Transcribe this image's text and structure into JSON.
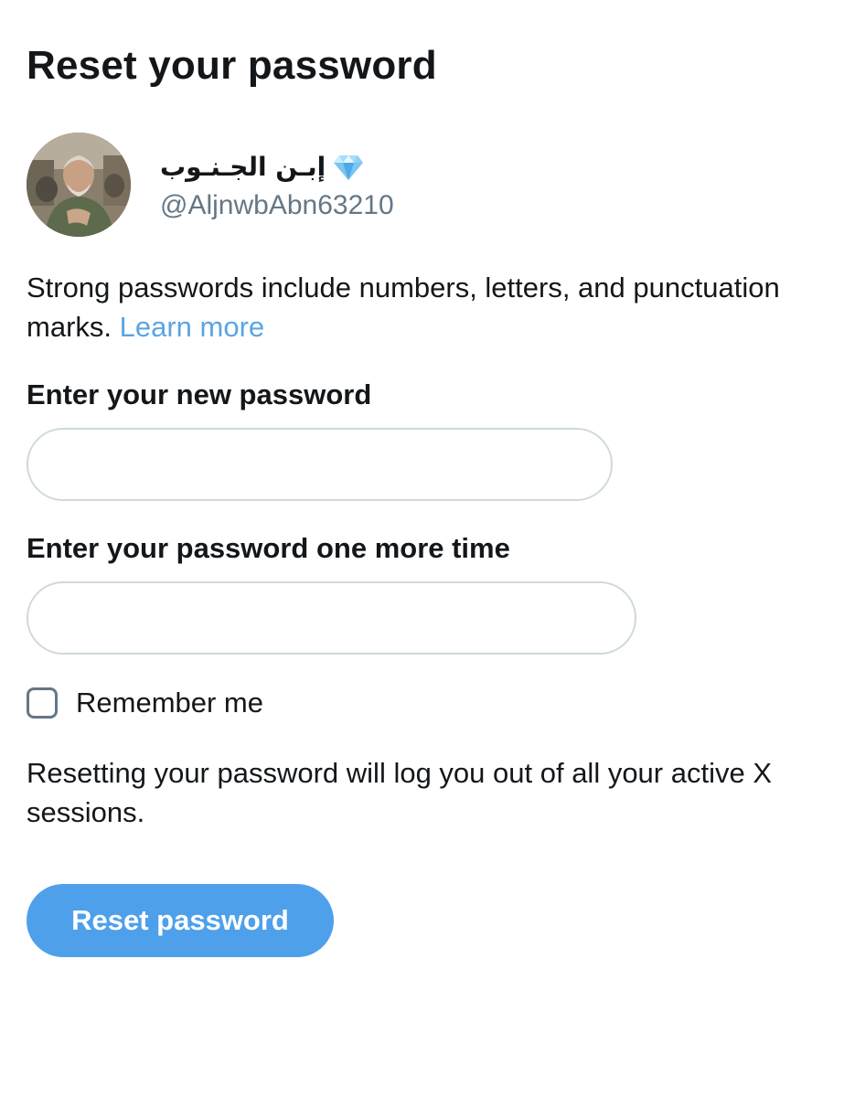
{
  "page": {
    "title": "Reset your password"
  },
  "account": {
    "display_name": "إبـن الجـنـوب",
    "badge_icon": "gem-icon",
    "handle": "@AljnwbAbn63210"
  },
  "info": {
    "text": "Strong passwords include numbers, letters, and punctuation marks.",
    "link_label": "Learn more"
  },
  "form": {
    "new_password_label": "Enter your new password",
    "new_password_value": "",
    "confirm_password_label": "Enter your password one more time",
    "confirm_password_value": "",
    "remember_label": "Remember me",
    "remember_checked": false
  },
  "notice": {
    "text": "Resetting your password will log you out of all your active X sessions."
  },
  "actions": {
    "reset_label": "Reset password"
  },
  "colors": {
    "accent": "#4ea0ea",
    "link": "#5aa5e3",
    "muted": "#657786",
    "border": "#cfd9de",
    "text": "#14171a"
  }
}
